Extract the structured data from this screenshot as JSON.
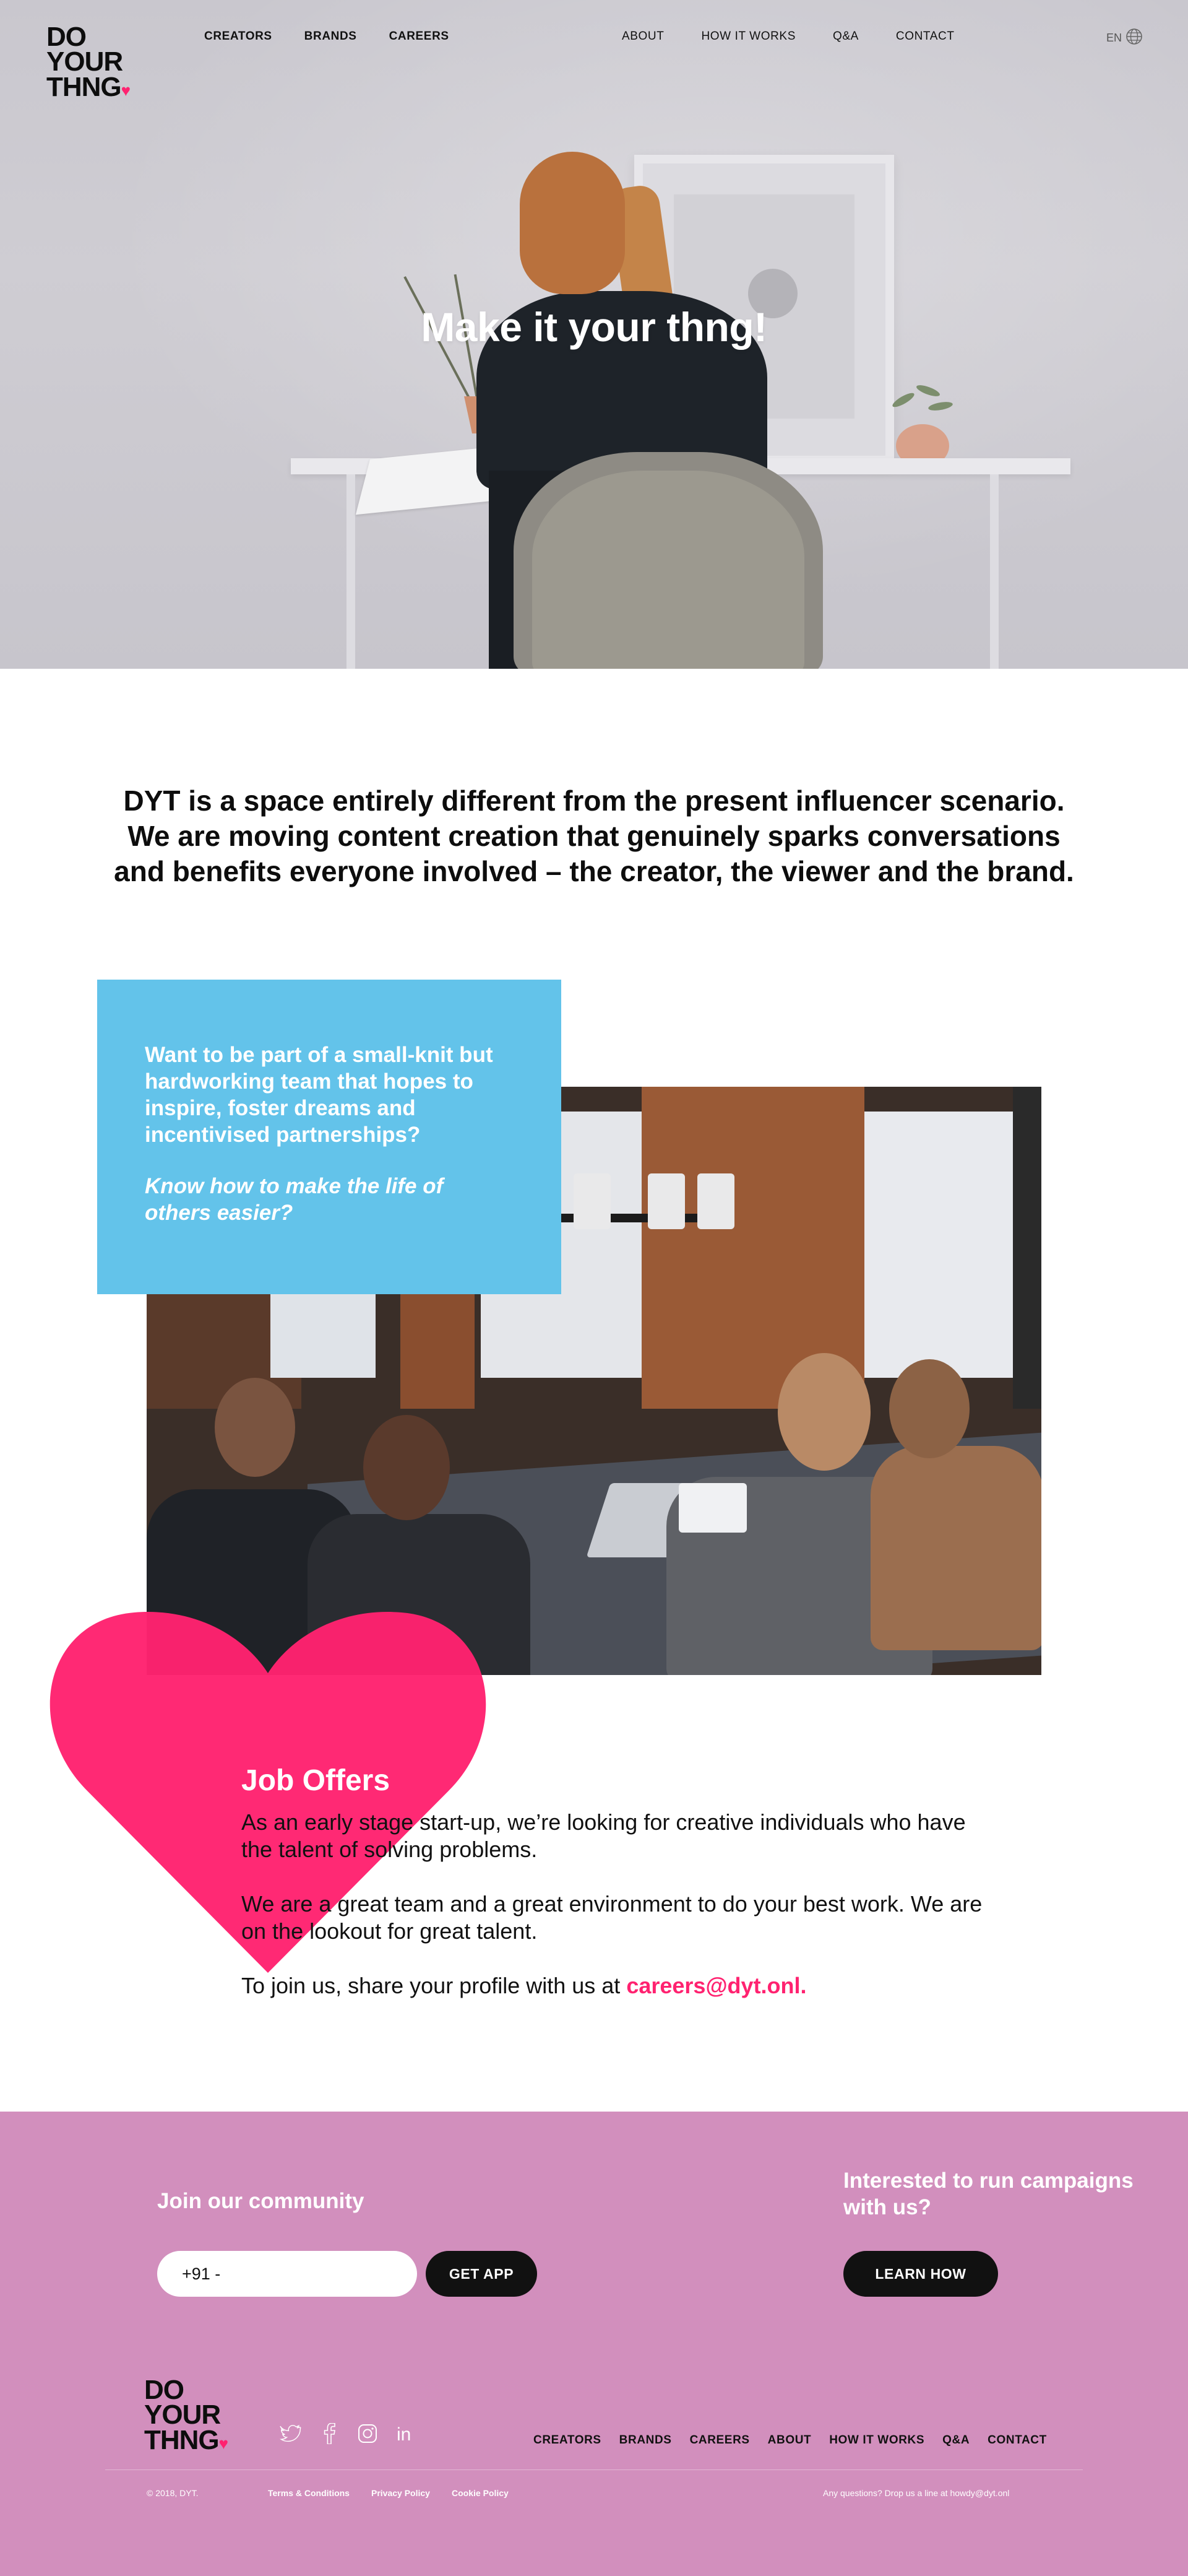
{
  "brand": {
    "logo_lines": [
      "DO",
      "YOUR",
      "THNG"
    ],
    "heart_color": "#ff2270"
  },
  "nav": {
    "left": [
      "CREATORS",
      "BRANDS",
      "CAREERS"
    ],
    "right": [
      "ABOUT",
      "HOW IT WORKS",
      "Q&A",
      "CONTACT"
    ],
    "language": "EN",
    "language_icon": "globe-icon"
  },
  "hero": {
    "title": "Make it your thng!"
  },
  "intro": {
    "text": "DYT is a space entirely different from the present influencer scenario. We are moving content creation that genuinely sparks conversations and benefits everyone involved – the creator, the viewer and the brand."
  },
  "callout": {
    "question": "Want to be part of a small-knit but hardworking team that hopes to inspire, foster dreams and incentivised partnerships?",
    "italic": "Know how to make the life of others easier?",
    "color": "#63c3ea"
  },
  "jobs": {
    "title": "Job Offers",
    "p1": "As an early stage start-up, we’re looking for creative individuals who have the talent of solving problems.",
    "p2": "We are a great team and a great environment to do your best work. We are on the lookout for great talent.",
    "p3_prefix": "To join us, share your profile with us at",
    "email": "careers@dyt.onl.",
    "accent": "#ff2270"
  },
  "footer": {
    "background": "#d28fbd",
    "community_title": "Join our community",
    "phone_value": "+91 -",
    "get_app": "GET APP",
    "campaign_title": "Interested to run campaigns with us?",
    "learn_how": "LEARN HOW",
    "social_icons": [
      "twitter-icon",
      "facebook-icon",
      "instagram-icon",
      "linkedin-icon"
    ],
    "nav": [
      "CREATORS",
      "BRANDS",
      "CAREERS",
      "ABOUT",
      "HOW IT WORKS",
      "Q&A",
      "CONTACT"
    ],
    "copyright": "© 2018, DYT.",
    "legal": [
      "Terms & Conditions",
      "Privacy Policy",
      "Cookie Policy"
    ],
    "questions": "Any questions? Drop us a line at howdy@dyt.onl"
  }
}
